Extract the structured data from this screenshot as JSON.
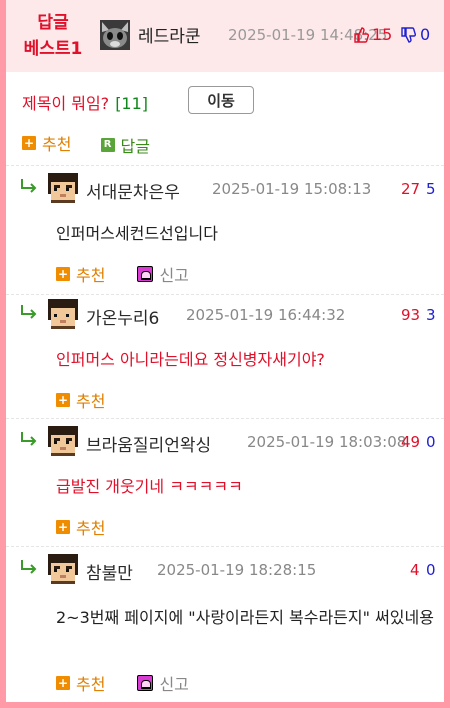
{
  "header": {
    "best_label_line1": "답글",
    "best_label_line2": "베스트1",
    "nickname": "레드라쿤",
    "datetime": "2025-01-19 14:48:25",
    "upvotes": "15",
    "downvotes": "0"
  },
  "post": {
    "title": "제목이 뭐임?",
    "comment_count": "[11]",
    "move_button": "이동",
    "recommend_label": "추천",
    "reply_label": "답글"
  },
  "comments": [
    {
      "nickname": "서대문차은우",
      "datetime": "2025-01-19 15:08:13",
      "upvotes": "27",
      "downvotes": "5",
      "text": "인퍼머스세컨드선입니다",
      "recommend_label": "추천",
      "report_label": "신고"
    },
    {
      "nickname": "가온누리6",
      "datetime": "2025-01-19 16:44:32",
      "upvotes": "93",
      "downvotes": "3",
      "text": "인퍼머스 아니라는데요 정신병자새기야?",
      "recommend_label": "추천"
    },
    {
      "nickname": "브라움질리언왁싱",
      "datetime": "2025-01-19 18:03:08",
      "upvotes": "49",
      "downvotes": "0",
      "text": "급발진 개웃기네 ㅋㅋㅋㅋㅋ",
      "recommend_label": "추천"
    },
    {
      "nickname": "참불만",
      "datetime": "2025-01-19 18:28:15",
      "upvotes": "4",
      "downvotes": "0",
      "text": "2~3번째 페이지에 \"사랑이라든지 복수라든지\" 써있네용",
      "recommend_label": "추천",
      "report_label": "신고"
    }
  ],
  "colors": {
    "frame": "#ff9aa6",
    "header_bg": "#fde8ea",
    "accent_red": "#e0102a",
    "accent_blue": "#2020d0",
    "count_green": "#11881d",
    "action_orange": "#e07f00"
  },
  "icons": {
    "reply_arrow": "reply-arrow-icon",
    "thumb_up": "thumbs-up-icon",
    "thumb_down": "thumbs-down-icon",
    "plus": "plus-icon",
    "reply_r": "reply-r-icon",
    "report": "report-icon"
  }
}
